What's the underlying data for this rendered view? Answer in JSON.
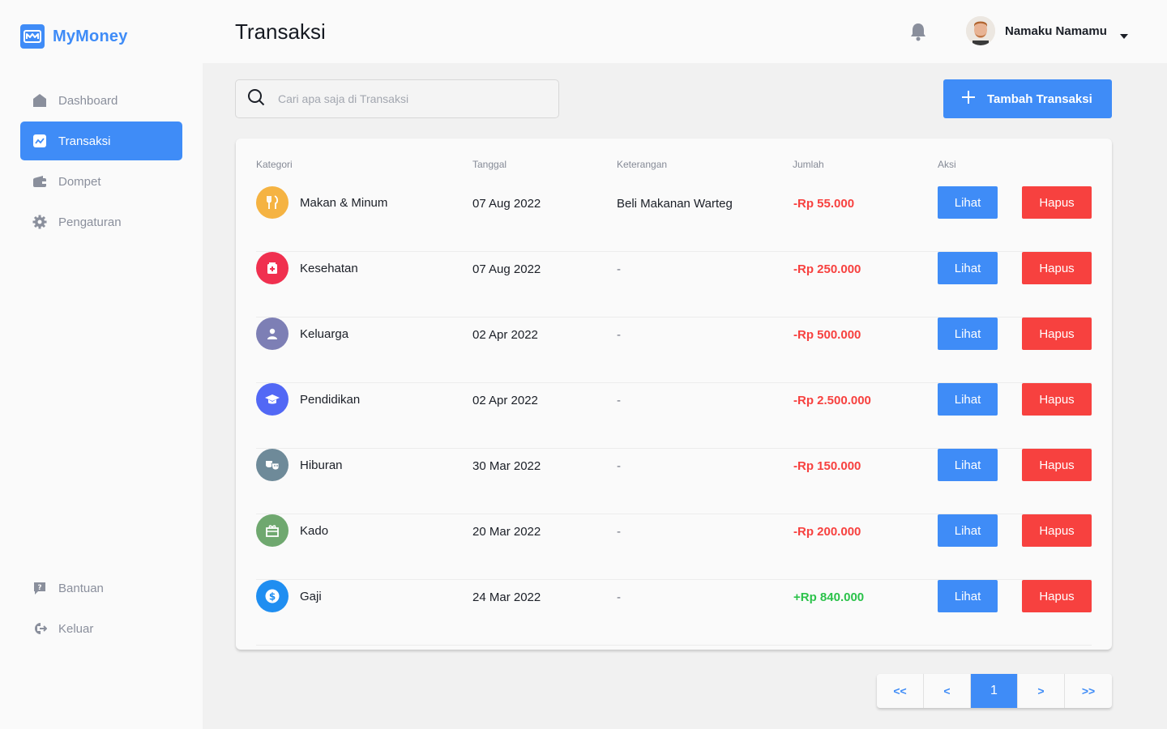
{
  "app": {
    "name": "MyMoney"
  },
  "sidebar": {
    "items": [
      {
        "label": "Dashboard",
        "icon": "home-icon"
      },
      {
        "label": "Transaksi",
        "icon": "chart-icon",
        "active": true
      },
      {
        "label": "Dompet",
        "icon": "wallet-icon"
      },
      {
        "label": "Pengaturan",
        "icon": "gear-icon"
      }
    ],
    "bottom_items": [
      {
        "label": "Bantuan",
        "icon": "help-icon"
      },
      {
        "label": "Keluar",
        "icon": "logout-icon"
      }
    ]
  },
  "header": {
    "title": "Transaksi",
    "user_name": "Namaku Namamu"
  },
  "search": {
    "placeholder": "Cari apa saja di Transaksi"
  },
  "toolbar": {
    "add_label": "Tambah Transaksi"
  },
  "table": {
    "headers": {
      "kategori": "Kategori",
      "tanggal": "Tanggal",
      "keterangan": "Keterangan",
      "jumlah": "Jumlah",
      "aksi": "Aksi"
    },
    "view_label": "Lihat",
    "delete_label": "Hapus",
    "rows": [
      {
        "category": "Makan & Minum",
        "icon": "fork-knife-icon",
        "color": "#f5b342",
        "date": "07 Aug 2022",
        "description": "Beli Makanan Warteg",
        "amount": "-Rp 55.000",
        "type": "out"
      },
      {
        "category": "Kesehatan",
        "icon": "medical-icon",
        "color": "#f0304f",
        "date": "07 Aug 2022",
        "description": "-",
        "amount": "-Rp 250.000",
        "type": "out"
      },
      {
        "category": "Keluarga",
        "icon": "person-icon",
        "color": "#7d7fb5",
        "date": "02 Apr 2022",
        "description": "-",
        "amount": "-Rp 500.000",
        "type": "out"
      },
      {
        "category": "Pendidikan",
        "icon": "graduation-cap-icon",
        "color": "#5268f5",
        "date": "02 Apr 2022",
        "description": "-",
        "amount": "-Rp 2.500.000",
        "type": "out"
      },
      {
        "category": "Hiburan",
        "icon": "theater-masks-icon",
        "color": "#6e8a99",
        "date": "30 Mar 2022",
        "description": "-",
        "amount": "-Rp 150.000",
        "type": "out"
      },
      {
        "category": "Kado",
        "icon": "gift-icon",
        "color": "#6fa86f",
        "date": "20 Mar 2022",
        "description": "-",
        "amount": "-Rp 200.000",
        "type": "out"
      },
      {
        "category": "Gaji",
        "icon": "dollar-icon",
        "color": "#1f8ef1",
        "date": "24 Mar 2022",
        "description": "-",
        "amount": "+Rp 840.000",
        "type": "in"
      }
    ]
  },
  "pagination": {
    "first": "<<",
    "prev": "<",
    "current": "1",
    "next": ">",
    "last": ">>"
  },
  "colors": {
    "primary": "#3f8cf7",
    "danger": "#f7413f",
    "expense": "#f7413f",
    "income": "#2bc24a"
  }
}
